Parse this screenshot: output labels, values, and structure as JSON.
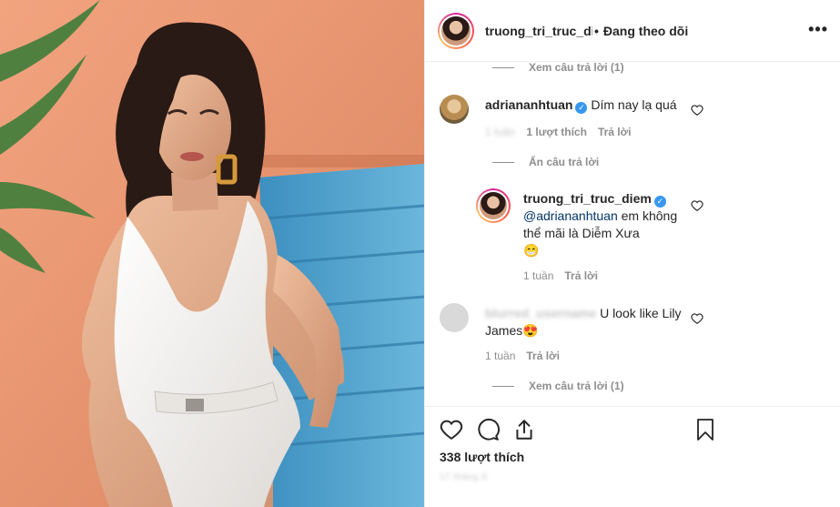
{
  "header": {
    "username": "truong_tri_truc_diem",
    "separator": "•",
    "follow_status": "Đang theo dõi",
    "more_glyph": "•••"
  },
  "comments": {
    "view_replies_top": "Xem câu trả lời (1)",
    "adrian": {
      "username": "adriananhtuan",
      "text": "Dím nay lạ quá",
      "time": "1 tuần",
      "likes": "1 lượt thích",
      "reply": "Trả lời"
    },
    "hide_replies": "Ẩn câu trả lời",
    "reply": {
      "username": "truong_tri_truc_diem",
      "mention": "@adriananhtuan",
      "text": " em không thể mãi là Diễm Xưa",
      "emoji": "😁",
      "time": "1 tuần",
      "reply": "Trả lời"
    },
    "blurred_comment": {
      "username": "blurred_username",
      "text": "U look like Lily James",
      "emoji": "😍",
      "time": "1 tuần",
      "reply": "Trả lời"
    },
    "view_replies_bottom": "Xem câu trả lời (1)"
  },
  "actions": {
    "likes": "338 lượt thích",
    "date": "17 tháng 4"
  },
  "colors": {
    "verified": "#3897f0",
    "muted": "#8e8e8e",
    "text": "#262626",
    "wall": "#e8956e",
    "bench": "#4a9ec9"
  }
}
